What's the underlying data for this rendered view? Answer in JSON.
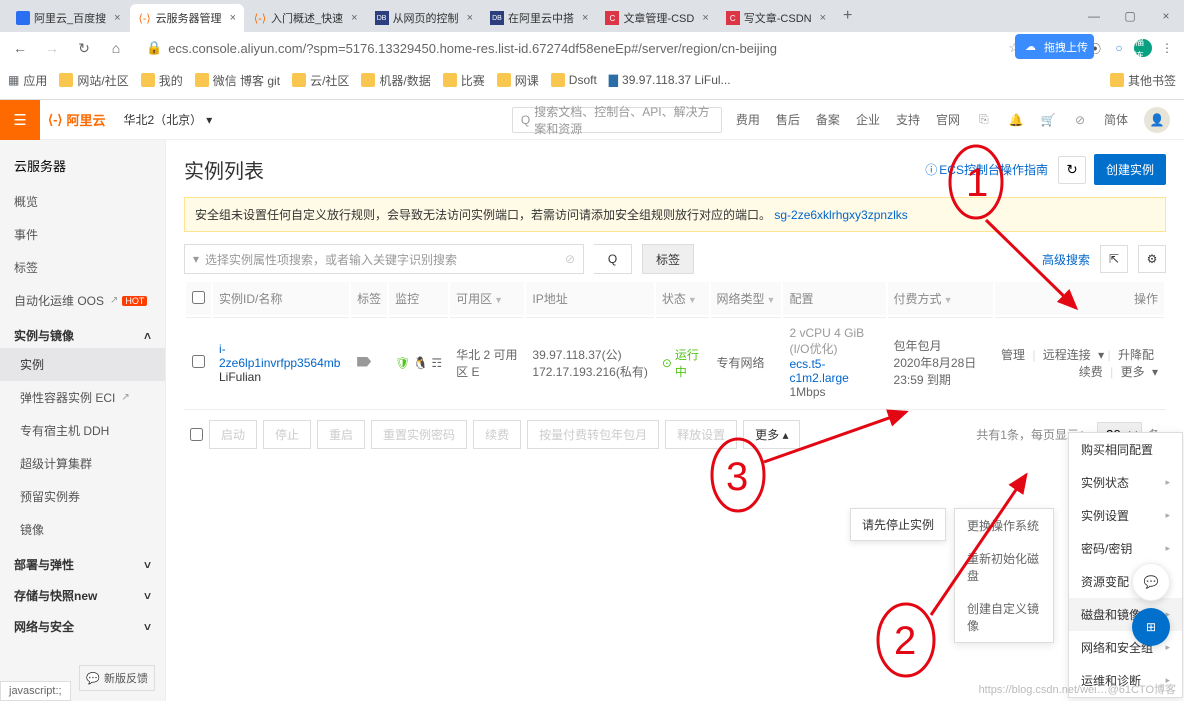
{
  "browser": {
    "tabs": [
      {
        "label": "阿里云_百度搜",
        "favicon": "baidu"
      },
      {
        "label": "云服务器管理",
        "favicon": "aliyun"
      },
      {
        "label": "入门概述_快速",
        "favicon": "aliyun"
      },
      {
        "label": "从网页的控制",
        "favicon": "dblab"
      },
      {
        "label": "在阿里云中搭",
        "favicon": "dblab"
      },
      {
        "label": "文章管理-CSD",
        "favicon": "csdn"
      },
      {
        "label": "写文章-CSDN",
        "favicon": "csdn"
      }
    ],
    "url": "ecs.console.aliyun.com/?spm=5176.13329450.home-res.list-id.67274df58eneEp#/server/region/cn-beijing",
    "userInitials": "福连",
    "uploadBadge": "拖拽上传",
    "bookmarks": [
      {
        "label": "应用",
        "ico": "apps"
      },
      {
        "label": "网站/社区"
      },
      {
        "label": "我的"
      },
      {
        "label": "微信 博客 git"
      },
      {
        "label": "云/社区"
      },
      {
        "label": "机器/数据"
      },
      {
        "label": "比赛"
      },
      {
        "label": "网课"
      },
      {
        "label": "Dsoft"
      },
      {
        "label": "39.97.118.37 LiFul...",
        "ico": "server"
      },
      {
        "label": "其他书签",
        "right": true
      }
    ]
  },
  "header": {
    "logoText": "阿里云",
    "region": "华北2（北京）",
    "searchPlaceholder": "搜索文档、控制台、API、解决方案和资源",
    "links": [
      "费用",
      "售后",
      "备案",
      "企业",
      "支持",
      "官网"
    ],
    "simple": "简体"
  },
  "sidebar": {
    "title": "云服务器",
    "items1": [
      {
        "label": "概览"
      },
      {
        "label": "事件"
      },
      {
        "label": "标签"
      },
      {
        "label": "自动化运维 OOS",
        "ext": true,
        "badge": "HOT"
      }
    ],
    "secInstances": "实例与镜像",
    "itemsInstances": [
      {
        "label": "实例",
        "active": true
      },
      {
        "label": "弹性容器实例 ECI",
        "ext": true
      },
      {
        "label": "专有宿主机 DDH"
      },
      {
        "label": "超级计算集群"
      },
      {
        "label": "预留实例券"
      },
      {
        "label": "镜像"
      }
    ],
    "secDeploy": "部署与弹性",
    "secStorage": "存储与快照",
    "storageBadge": "new",
    "secNetwork": "网络与安全",
    "feedback": "新版反馈"
  },
  "page": {
    "title": "实例列表",
    "guide": "ECS控制台操作指南",
    "createBtn": "创建实例",
    "noticeText": "安全组未设置任何自定义放行规则，会导致无法访问实例端口，若需访问请添加安全组规则放行对应的端口。",
    "noticeLink": "sg-2ze6xklrhgxy3zpnzlks",
    "searchPlaceholder": "选择实例属性项搜索，或者输入关键字识别搜索",
    "tagsBtn": "标签",
    "advSearch": "高级搜索"
  },
  "table": {
    "cols": {
      "chk": "",
      "id": "实例ID/名称",
      "tags": "标签",
      "monitor": "监控",
      "zone": "可用区",
      "ip": "IP地址",
      "status": "状态",
      "netType": "网络类型",
      "config": "配置",
      "billing": "付费方式",
      "actions": "操作"
    },
    "row": {
      "id": "i-2ze6lp1invrfpp3564mb",
      "name": "LiFulian",
      "zone": "华北 2 可用区 E",
      "ipPub": "39.97.118.37(公)",
      "ipPriv": "172.17.193.216(私有)",
      "status": "运行中",
      "netType": "专有网络",
      "cfg1": "2 vCPU 4 GiB (I/O优化)",
      "cfg2": "ecs.t5-c1m2.large",
      "bw": "1Mbps",
      "bill1": "包年包月",
      "bill2": "2020年8月28日 23:59 到期",
      "act_manage": "管理",
      "act_conn": "远程连接",
      "act_upgrade": "升降配",
      "act_renew": "续费",
      "act_more": "更多"
    },
    "batch": {
      "start": "启动",
      "stop": "停止",
      "restart": "重启",
      "reset": "重置实例密码",
      "renew": "续费",
      "convert": "按量付费转包年包月",
      "release": "释放设置",
      "more": "更多"
    },
    "pagination": "共有1条，每页显示：",
    "pageSize": "20",
    "pageUnit": "条"
  },
  "stopFirst": "请先停止实例",
  "dropdown1": {
    "i1": "更换操作系统",
    "i2": "重新初始化磁盘",
    "i3": "创建自定义镜像"
  },
  "dropdown2": {
    "i1": "购买相同配置",
    "i2": "实例状态",
    "i3": "实例设置",
    "i4": "密码/密钥",
    "i5": "资源变配",
    "i6": "磁盘和镜像",
    "i7": "网络和安全组",
    "i8": "运维和诊断"
  },
  "statusBar": "javascript:;",
  "watermark": "https://blog.csdn.net/wei…@61CTO博客"
}
